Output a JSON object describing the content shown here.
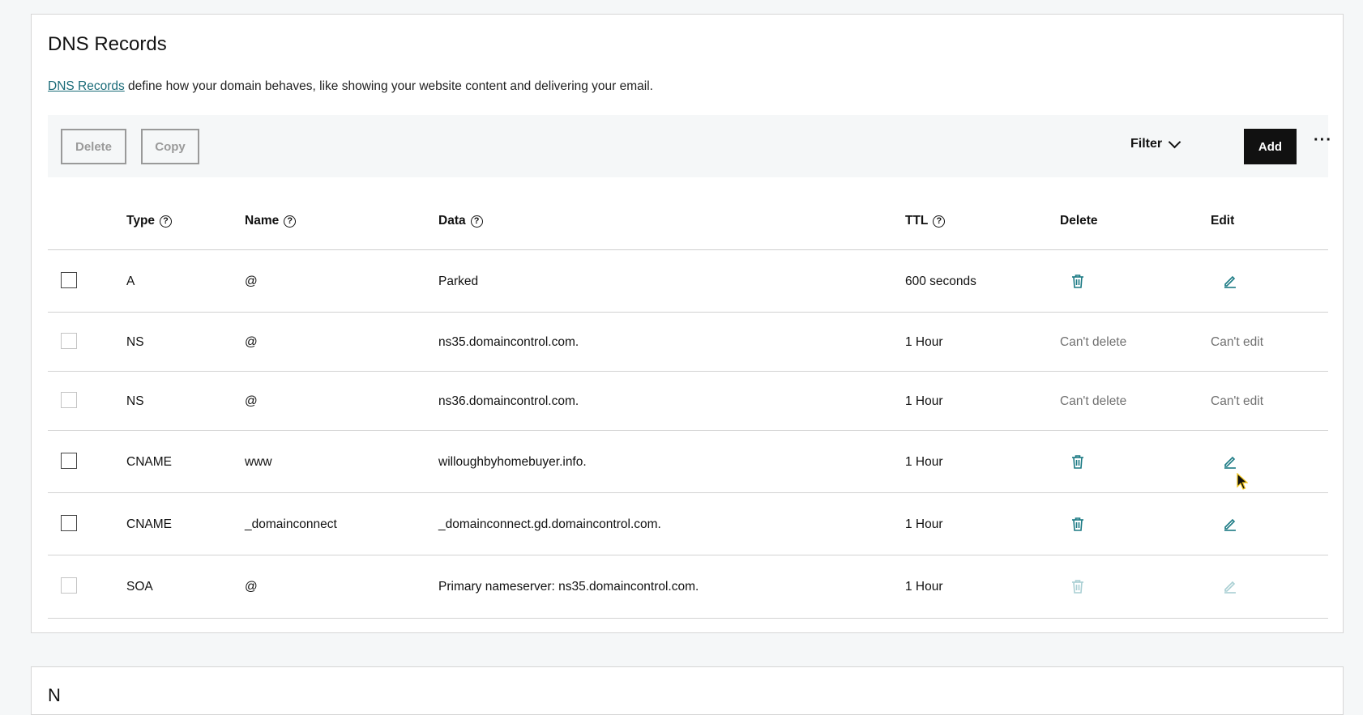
{
  "section": {
    "title": "DNS Records",
    "description_link": "DNS Records",
    "description_rest": " define how your domain behaves, like showing your website content and delivering your email."
  },
  "toolbar": {
    "delete_label": "Delete",
    "copy_label": "Copy",
    "filter_label": "Filter",
    "add_label": "Add",
    "more_label": "···"
  },
  "table": {
    "columns": {
      "type": "Type",
      "name": "Name",
      "data": "Data",
      "ttl": "TTL",
      "delete": "Delete",
      "edit": "Edit"
    },
    "rows": [
      {
        "type": "A",
        "name": "@",
        "data": "Parked",
        "ttl": "600 seconds",
        "delete": "trash-icon",
        "edit": "pencil-icon"
      },
      {
        "type": "NS",
        "name": "@",
        "data": "ns35.domaincontrol.com.",
        "ttl": "1 Hour",
        "delete": "Can't delete",
        "edit": "Can't edit"
      },
      {
        "type": "NS",
        "name": "@",
        "data": "ns36.domaincontrol.com.",
        "ttl": "1 Hour",
        "delete": "Can't delete",
        "edit": "Can't edit"
      },
      {
        "type": "CNAME",
        "name": "www",
        "data": "willoughbyhomebuyer.info.",
        "ttl": "1 Hour",
        "delete": "trash-icon",
        "edit": "pencil-icon"
      },
      {
        "type": "CNAME",
        "name": "_domainconnect",
        "data": "_domainconnect.gd.domaincontrol.com.",
        "ttl": "1 Hour",
        "delete": "trash-icon",
        "edit": "pencil-icon"
      },
      {
        "type": "SOA",
        "name": "@",
        "data": "Primary nameserver: ns35.domaincontrol.com.",
        "ttl": "1 Hour",
        "delete": "trash-icon-disabled",
        "edit": "pencil-icon-disabled"
      }
    ]
  },
  "next_section": {
    "title_partial": "N"
  },
  "colors": {
    "accent": "#1a6b78",
    "icon_teal": "#1b7a84",
    "icon_disabled": "#a9cfd3",
    "add_button_bg": "#111111",
    "toolbar_bg": "#f5f7f8"
  }
}
